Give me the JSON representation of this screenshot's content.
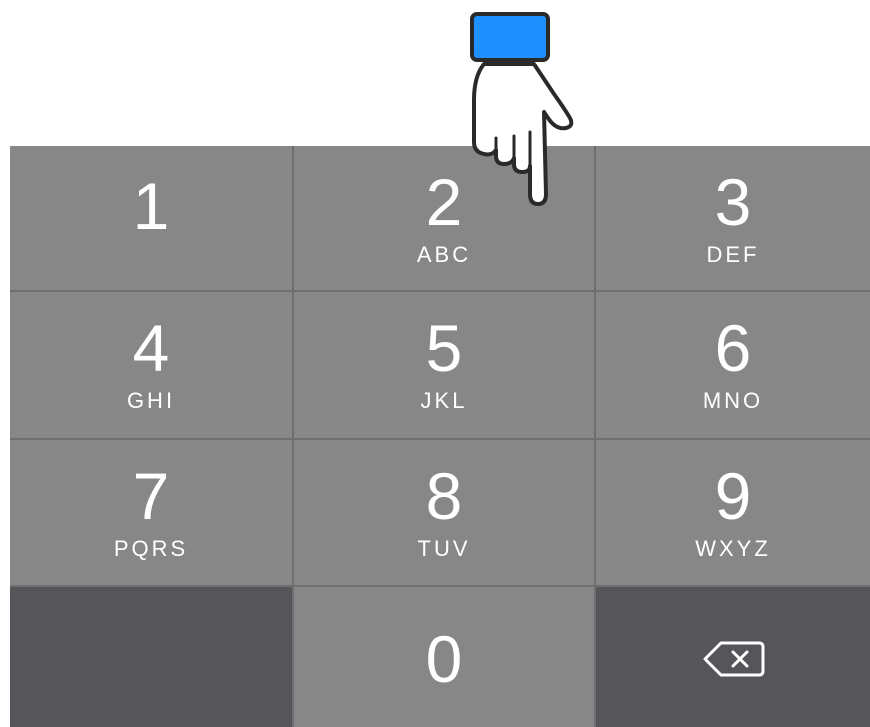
{
  "keypad": {
    "keys": [
      {
        "digit": "1",
        "letters": ""
      },
      {
        "digit": "2",
        "letters": "ABC"
      },
      {
        "digit": "3",
        "letters": "DEF"
      },
      {
        "digit": "4",
        "letters": "GHI"
      },
      {
        "digit": "5",
        "letters": "JKL"
      },
      {
        "digit": "6",
        "letters": "MNO"
      },
      {
        "digit": "7",
        "letters": "PQRS"
      },
      {
        "digit": "8",
        "letters": "TUV"
      },
      {
        "digit": "9",
        "letters": "WXYZ"
      },
      {
        "digit": "0",
        "letters": ""
      }
    ],
    "empty_key": "blank-key",
    "delete_key_icon": "backspace-icon"
  },
  "pointer": {
    "icon": "pointing-hand-icon",
    "target_key": "2",
    "cuff_color": "#1e90ff"
  },
  "colors": {
    "key": "#878787",
    "key_dark": "#56555a",
    "separator": "#6f6f6f",
    "text": "#ffffff"
  }
}
